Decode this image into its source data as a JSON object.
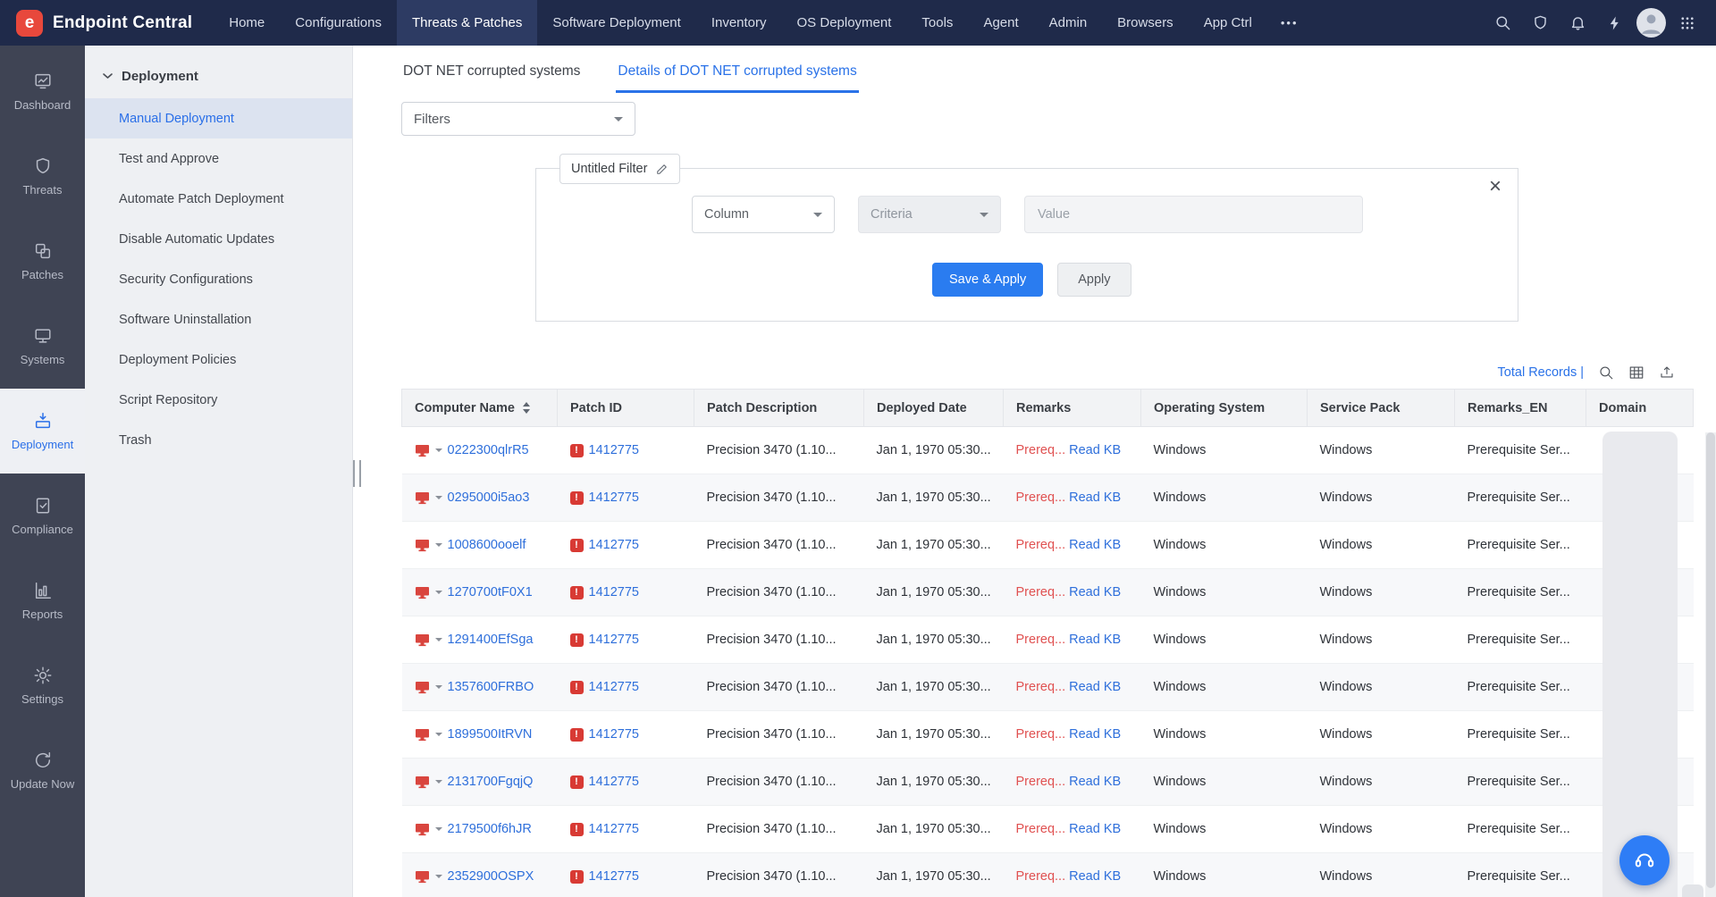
{
  "icons": {
    "caret_down": "▾",
    "more": "•••",
    "close": "×",
    "logo_glyph": "e",
    "warning_glyph": "!"
  },
  "topnav": {
    "brand": "Endpoint Central",
    "items": [
      "Home",
      "Configurations",
      "Threats & Patches",
      "Software Deployment",
      "Inventory",
      "OS Deployment",
      "Tools",
      "Agent",
      "Admin",
      "Browsers",
      "App Ctrl"
    ],
    "active_item": "Threats & Patches"
  },
  "rail": {
    "active_item": "Deployment",
    "items": [
      {
        "label": "Dashboard"
      },
      {
        "label": "Threats"
      },
      {
        "label": "Patches"
      },
      {
        "label": "Systems"
      },
      {
        "label": "Deployment"
      },
      {
        "label": "Compliance"
      },
      {
        "label": "Reports"
      },
      {
        "label": "Settings"
      },
      {
        "label": "Update Now"
      }
    ]
  },
  "sidebar": {
    "section_label": "Deployment",
    "selected_item": "Manual Deployment",
    "items": [
      "Manual Deployment",
      "Test and Approve",
      "Automate Patch Deployment",
      "Disable Automatic Updates",
      "Security Configurations",
      "Software Uninstallation",
      "Deployment Policies",
      "Script Repository",
      "Trash"
    ]
  },
  "main": {
    "tabs": [
      "DOT NET corrupted systems",
      "Details of DOT NET corrupted systems"
    ],
    "active_tab": "Details of DOT NET corrupted systems",
    "filters_label": "Filters",
    "filter_panel": {
      "name": "Untitled Filter",
      "column_label": "Column",
      "criteria_label": "Criteria",
      "value_placeholder": "Value",
      "save_apply_label": "Save & Apply",
      "apply_label": "Apply"
    },
    "toolbar": {
      "total_records_label": "Total Records |"
    },
    "table": {
      "columns": [
        "Computer Name",
        "Patch ID",
        "Patch Description",
        "Deployed Date",
        "Remarks",
        "Operating System",
        "Service Pack",
        "Remarks_EN",
        "Domain"
      ],
      "rows": [
        {
          "computer": "0222300qlrR5",
          "patch_id": "1412775",
          "description": "Precision 3470 (1.10...",
          "deployed_date": "Jan 1, 1970 05:30...",
          "remarks": "Prereq...",
          "read_kb": "Read KB",
          "os": "Windows",
          "service_pack": "Windows",
          "remarks_en": "Prerequisite Ser..."
        },
        {
          "computer": "0295000i5ao3",
          "patch_id": "1412775",
          "description": "Precision 3470 (1.10...",
          "deployed_date": "Jan 1, 1970 05:30...",
          "remarks": "Prereq...",
          "read_kb": "Read KB",
          "os": "Windows",
          "service_pack": "Windows",
          "remarks_en": "Prerequisite Ser..."
        },
        {
          "computer": "1008600ooelf",
          "patch_id": "1412775",
          "description": "Precision 3470 (1.10...",
          "deployed_date": "Jan 1, 1970 05:30...",
          "remarks": "Prereq...",
          "read_kb": "Read KB",
          "os": "Windows",
          "service_pack": "Windows",
          "remarks_en": "Prerequisite Ser..."
        },
        {
          "computer": "1270700tF0X1",
          "patch_id": "1412775",
          "description": "Precision 3470 (1.10...",
          "deployed_date": "Jan 1, 1970 05:30...",
          "remarks": "Prereq...",
          "read_kb": "Read KB",
          "os": "Windows",
          "service_pack": "Windows",
          "remarks_en": "Prerequisite Ser..."
        },
        {
          "computer": "1291400EfSga",
          "patch_id": "1412775",
          "description": "Precision 3470 (1.10...",
          "deployed_date": "Jan 1, 1970 05:30...",
          "remarks": "Prereq...",
          "read_kb": "Read KB",
          "os": "Windows",
          "service_pack": "Windows",
          "remarks_en": "Prerequisite Ser..."
        },
        {
          "computer": "1357600FRBO",
          "patch_id": "1412775",
          "description": "Precision 3470 (1.10...",
          "deployed_date": "Jan 1, 1970 05:30...",
          "remarks": "Prereq...",
          "read_kb": "Read KB",
          "os": "Windows",
          "service_pack": "Windows",
          "remarks_en": "Prerequisite Ser..."
        },
        {
          "computer": "1899500ItRVN",
          "patch_id": "1412775",
          "description": "Precision 3470 (1.10...",
          "deployed_date": "Jan 1, 1970 05:30...",
          "remarks": "Prereq...",
          "read_kb": "Read KB",
          "os": "Windows",
          "service_pack": "Windows",
          "remarks_en": "Prerequisite Ser..."
        },
        {
          "computer": "2131700FgqjQ",
          "patch_id": "1412775",
          "description": "Precision 3470 (1.10...",
          "deployed_date": "Jan 1, 1970 05:30...",
          "remarks": "Prereq...",
          "read_kb": "Read KB",
          "os": "Windows",
          "service_pack": "Windows",
          "remarks_en": "Prerequisite Ser..."
        },
        {
          "computer": "2179500f6hJR",
          "patch_id": "1412775",
          "description": "Precision 3470 (1.10...",
          "deployed_date": "Jan 1, 1970 05:30...",
          "remarks": "Prereq...",
          "read_kb": "Read KB",
          "os": "Windows",
          "service_pack": "Windows",
          "remarks_en": "Prerequisite Ser..."
        },
        {
          "computer": "2352900OSPX",
          "patch_id": "1412775",
          "description": "Precision 3470 (1.10...",
          "deployed_date": "Jan 1, 1970 05:30...",
          "remarks": "Prereq...",
          "read_kb": "Read KB",
          "os": "Windows",
          "service_pack": "Windows",
          "remarks_en": "Prerequisite Ser..."
        }
      ]
    }
  }
}
